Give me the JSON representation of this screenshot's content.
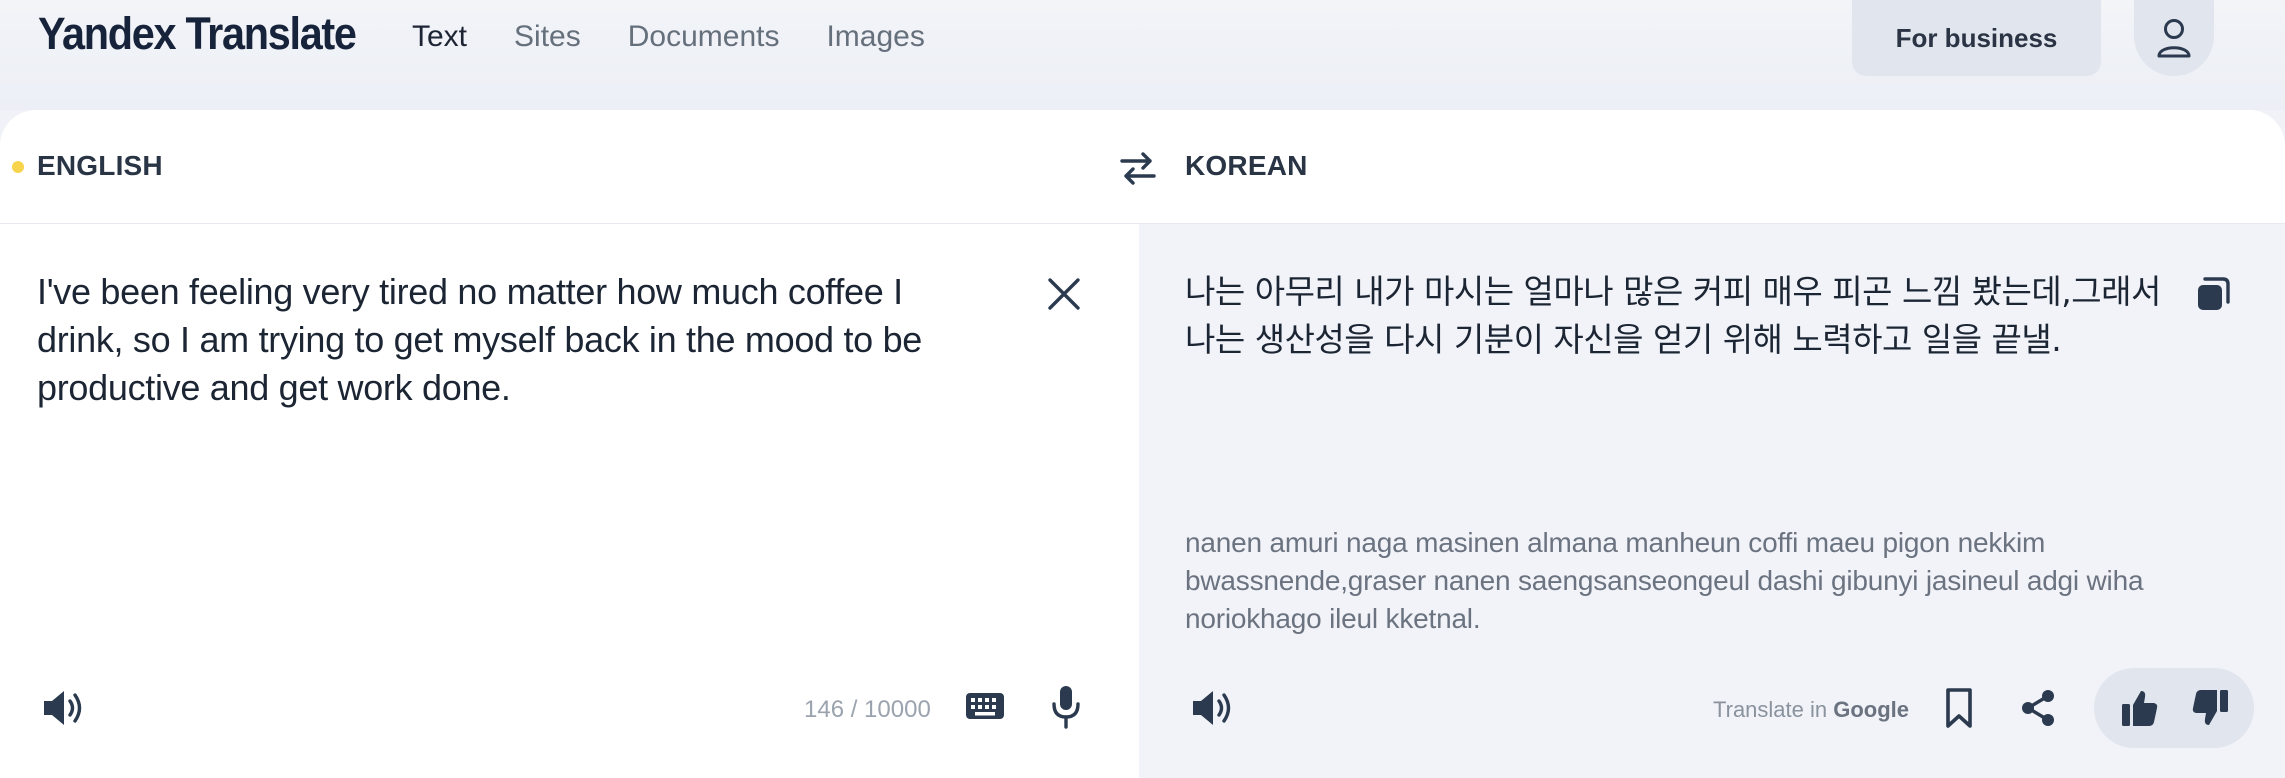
{
  "header": {
    "logo": "Yandex Translate",
    "nav": [
      {
        "label": "Text",
        "active": true
      },
      {
        "label": "Sites",
        "active": false
      },
      {
        "label": "Documents",
        "active": false
      },
      {
        "label": "Images",
        "active": false
      }
    ],
    "business_label": "For business",
    "user_icon": "user-icon"
  },
  "languages": {
    "source": "ENGLISH",
    "target": "KOREAN",
    "swap_icon": "swap-arrows-icon",
    "source_dot_color": "#f7d44c"
  },
  "source": {
    "text": "I've been feeling very tired no matter how much coffee I drink, so I am trying to get myself back in the mood to be productive and get work done.",
    "counter": "146 / 10000",
    "icons": [
      "clear-icon",
      "speaker-icon",
      "keyboard-icon",
      "microphone-icon"
    ]
  },
  "target": {
    "text": "나는 아무리 내가 마시는 얼마나 많은 커피 매우 피곤 느낌 봤는데,그래서 나는 생산성을 다시 기분이 자신을 얻기 위해 노력하고 일을 끝낼.",
    "transliteration": "nanen amuri naga masinen almana manheun coffi maeu pigon nekkim bwassnende,graser nanen saengsanseongeul dashi gibunyi jasineul adgi wiha noriokhago ileul kketnal.",
    "google_prefix": "Translate in",
    "google_name": "Google",
    "icons": [
      "copy-icon",
      "speaker-icon",
      "bookmark-icon",
      "share-icon",
      "thumbs-up-icon",
      "thumbs-down-icon"
    ]
  },
  "colors": {
    "background": "#f0f2f7",
    "card": "#ffffff",
    "target_pane": "#f1f3f8",
    "button_bg": "#e1e5ed",
    "icon": "#2b3a4f"
  }
}
